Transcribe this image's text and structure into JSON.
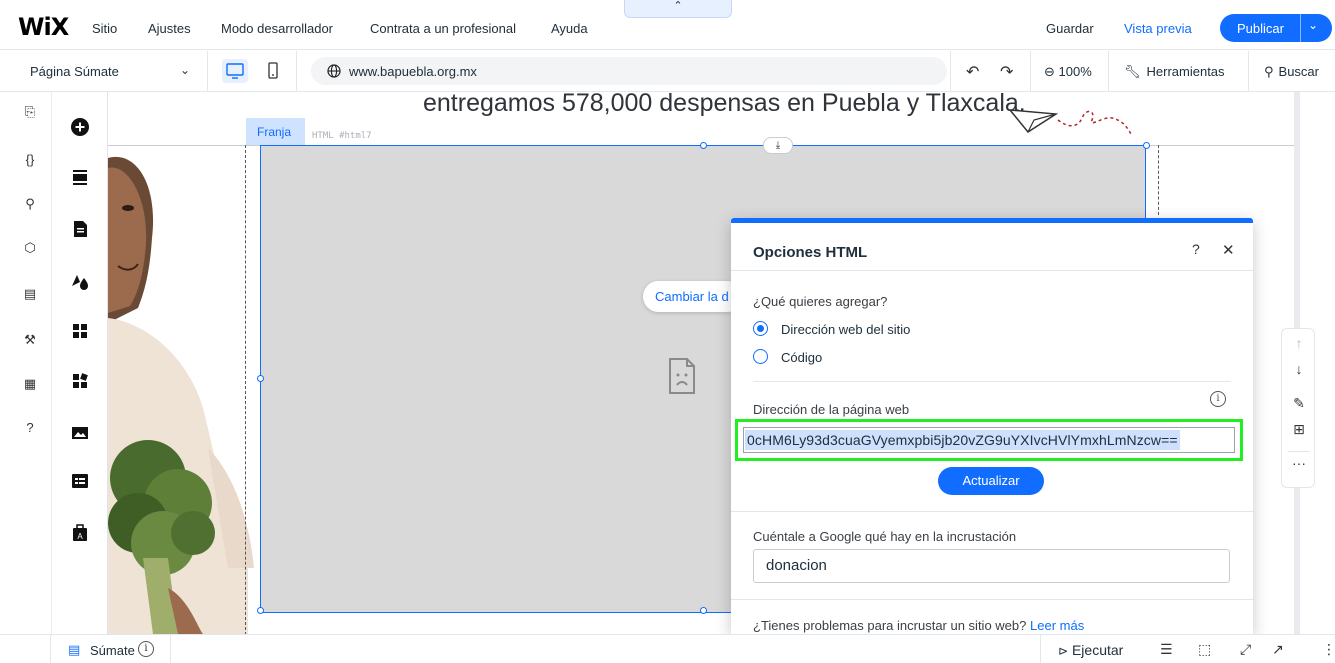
{
  "topbar": {
    "logo": "WiX",
    "menu": [
      "Sitio",
      "Ajustes",
      "Modo desarrollador",
      "Contrata a un profesional",
      "Ayuda"
    ],
    "handle": "⌃",
    "save": "Guardar",
    "preview": "Vista previa",
    "publish": "Publicar",
    "publish_chevron": "⌄"
  },
  "secondbar": {
    "page": "Página Súmate",
    "page_chevron": "⌄",
    "url": "www.bapuebla.org.mx",
    "zoom": "⊖ 100%",
    "tools": "Herramientas",
    "search": "Buscar"
  },
  "canvas": {
    "headline": "entregamos 578,000 despensas en Puebla y Tlaxcala.",
    "strip_label": "Franja",
    "html_tag": "HTML #html7",
    "change_button": "Cambiar la d",
    "download_icon": "⤓"
  },
  "panel": {
    "title": "Opciones HTML",
    "help": "?",
    "close": "✕",
    "question": "¿Qué quieres agregar?",
    "options": [
      "Dirección web del sitio",
      "Código"
    ],
    "selected_option": 0,
    "url_label": "Dirección de la página web",
    "url_value": "0cHM6Ly93d3cuaGVyemxpbi5jb20vZG9uYXIvcHVlYmxhLmNzcw==",
    "update_button": "Actualizar",
    "google_label": "Cuéntale a Google qué hay en la incrustación",
    "google_value": "donacion",
    "problem_text": "¿Tienes problemas para incrustar un sitio web?",
    "problem_link": "Leer más"
  },
  "bottombar": {
    "page_name": "Súmate",
    "run": "Ejecutar"
  },
  "colors": {
    "accent": "#116dff",
    "highlight_frame": "#22ee22"
  }
}
